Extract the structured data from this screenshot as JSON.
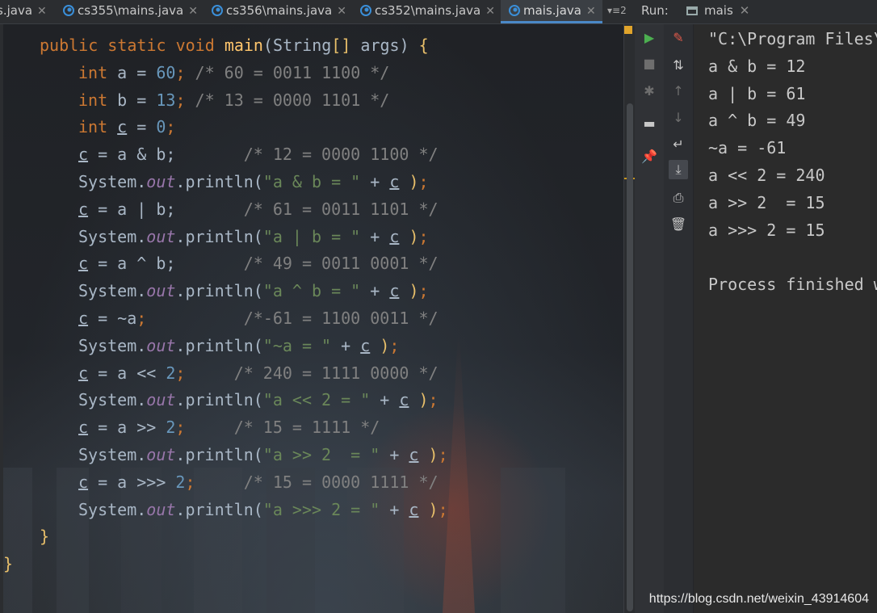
{
  "tabs": [
    {
      "name": "s.java",
      "active": false
    },
    {
      "name": "cs355\\mains.java",
      "active": false
    },
    {
      "name": "cs356\\mains.java",
      "active": false
    },
    {
      "name": "cs352\\mains.java",
      "active": false
    },
    {
      "name": "mais.java",
      "active": true
    }
  ],
  "tab_overflow_label": "≡2",
  "run": {
    "label": "Run:",
    "tab_name": "mais"
  },
  "editor": {
    "lines": [
      [
        [
          "kw",
          "public "
        ],
        [
          "kw",
          "static "
        ],
        [
          "kw",
          "void "
        ],
        [
          "fn",
          "main"
        ],
        [
          "p",
          "(String"
        ],
        [
          "br",
          "[]"
        ],
        [
          "p",
          " args) "
        ],
        [
          "br",
          "{"
        ]
      ],
      [
        [
          "kw",
          "int "
        ],
        [
          "p",
          "a = "
        ],
        [
          "num",
          "60"
        ],
        [
          "kw",
          "; "
        ],
        [
          "cm",
          "/* 60 = 0011 1100 */"
        ]
      ],
      [
        [
          "kw",
          "int "
        ],
        [
          "p",
          "b = "
        ],
        [
          "num",
          "13"
        ],
        [
          "kw",
          "; "
        ],
        [
          "cm",
          "/* 13 = 0000 1101 */"
        ]
      ],
      [
        [
          "kw",
          "int "
        ],
        [
          "var",
          "c"
        ],
        [
          "p",
          " = "
        ],
        [
          "num",
          "0"
        ],
        [
          "kw",
          ";"
        ]
      ],
      [
        [
          "var",
          "c"
        ],
        [
          "p",
          " = a & b;       "
        ],
        [
          "cm",
          "/* 12 = 0000 1100 */"
        ]
      ],
      [
        [
          "p",
          "System."
        ],
        [
          "fld",
          "out"
        ],
        [
          "p",
          ".println("
        ],
        [
          "st",
          "\"a & b = \""
        ],
        [
          "p",
          " + "
        ],
        [
          "var",
          "c"
        ],
        [
          "p",
          " "
        ],
        [
          "br",
          ")"
        ],
        [
          "kw",
          ";"
        ]
      ],
      [
        [
          "var",
          "c"
        ],
        [
          "p",
          " = a | b;       "
        ],
        [
          "cm",
          "/* 61 = 0011 1101 */"
        ]
      ],
      [
        [
          "p",
          "System."
        ],
        [
          "fld",
          "out"
        ],
        [
          "p",
          ".println("
        ],
        [
          "st",
          "\"a | b = \""
        ],
        [
          "p",
          " + "
        ],
        [
          "var",
          "c"
        ],
        [
          "p",
          " "
        ],
        [
          "br",
          ")"
        ],
        [
          "kw",
          ";"
        ]
      ],
      [
        [
          "var",
          "c"
        ],
        [
          "p",
          " = a ^ b;       "
        ],
        [
          "cm",
          "/* 49 = 0011 0001 */"
        ]
      ],
      [
        [
          "p",
          "System."
        ],
        [
          "fld",
          "out"
        ],
        [
          "p",
          ".println("
        ],
        [
          "st",
          "\"a ^ b = \""
        ],
        [
          "p",
          " + "
        ],
        [
          "var",
          "c"
        ],
        [
          "p",
          " "
        ],
        [
          "br",
          ")"
        ],
        [
          "kw",
          ";"
        ]
      ],
      [
        [
          "var",
          "c"
        ],
        [
          "p",
          " = ~a"
        ],
        [
          "kw",
          ";"
        ],
        [
          "p",
          "          "
        ],
        [
          "cm",
          "/*-61 = 1100 0011 */"
        ]
      ],
      [
        [
          "p",
          "System."
        ],
        [
          "fld",
          "out"
        ],
        [
          "p",
          ".println("
        ],
        [
          "st",
          "\"~a = \""
        ],
        [
          "p",
          " + "
        ],
        [
          "var",
          "c"
        ],
        [
          "p",
          " "
        ],
        [
          "br",
          ")"
        ],
        [
          "kw",
          ";"
        ]
      ],
      [
        [
          "var",
          "c"
        ],
        [
          "p",
          " = a << "
        ],
        [
          "num",
          "2"
        ],
        [
          "kw",
          ";"
        ],
        [
          "p",
          "     "
        ],
        [
          "cm",
          "/* 240 = 1111 0000 */"
        ]
      ],
      [
        [
          "p",
          "System."
        ],
        [
          "fld",
          "out"
        ],
        [
          "p",
          ".println("
        ],
        [
          "st",
          "\"a << 2 = \""
        ],
        [
          "p",
          " + "
        ],
        [
          "var",
          "c"
        ],
        [
          "p",
          " "
        ],
        [
          "br",
          ")"
        ],
        [
          "kw",
          ";"
        ]
      ],
      [
        [
          "var",
          "c"
        ],
        [
          "p",
          " = a >> "
        ],
        [
          "num",
          "2"
        ],
        [
          "kw",
          ";"
        ],
        [
          "p",
          "     "
        ],
        [
          "cm",
          "/* 15 = 1111 */"
        ]
      ],
      [
        [
          "p",
          "System."
        ],
        [
          "fld",
          "out"
        ],
        [
          "p",
          ".println("
        ],
        [
          "st",
          "\"a >> 2  = \""
        ],
        [
          "p",
          " + "
        ],
        [
          "var",
          "c"
        ],
        [
          "p",
          " "
        ],
        [
          "br",
          ")"
        ],
        [
          "kw",
          ";"
        ]
      ],
      [
        [
          "var",
          "c"
        ],
        [
          "p",
          " = a >>> "
        ],
        [
          "num",
          "2"
        ],
        [
          "kw",
          ";"
        ],
        [
          "p",
          "     "
        ],
        [
          "cm",
          "/* 15 = 0000 1111 */"
        ]
      ],
      [
        [
          "p",
          "System."
        ],
        [
          "fld",
          "out"
        ],
        [
          "p",
          ".println("
        ],
        [
          "st",
          "\"a >>> 2 = \""
        ],
        [
          "p",
          " + "
        ],
        [
          "var",
          "c"
        ],
        [
          "p",
          " "
        ],
        [
          "br",
          ")"
        ],
        [
          "kw",
          ";"
        ]
      ],
      [
        [
          "br",
          "}"
        ]
      ],
      [
        [
          "br",
          "}"
        ]
      ]
    ],
    "indents": [
      1,
      2,
      2,
      2,
      2,
      2,
      2,
      2,
      2,
      2,
      2,
      2,
      2,
      2,
      2,
      2,
      2,
      2,
      1,
      0
    ]
  },
  "console": {
    "lines": [
      "\"C:\\Program Files\\",
      "a & b = 12",
      "a | b = 61",
      "a ^ b = 49",
      "~a = -61",
      "a << 2 = 240",
      "a >> 2  = 15",
      "a >>> 2 = 15",
      "",
      "Process finished w"
    ]
  },
  "toolbar_left": [
    {
      "icon": "run-icon",
      "glyph": "▶",
      "color": "#4caf50"
    },
    {
      "icon": "stop-icon",
      "glyph": "■",
      "color": "#6e6e6e"
    },
    {
      "icon": "debug-icon",
      "glyph": "✱",
      "color": "#6e6e6e"
    },
    {
      "icon": "layout-icon",
      "glyph": "▬",
      "color": "#c8c8c8"
    },
    {
      "icon": "pin-icon",
      "glyph": "📌",
      "color": "#c8c8c8"
    }
  ],
  "toolbar_right": [
    {
      "icon": "clear-icon",
      "glyph": "✎",
      "color": "#e05a4a"
    },
    {
      "icon": "sort-icon",
      "glyph": "⇅",
      "color": "#c8c8c8"
    },
    {
      "icon": "up-icon",
      "glyph": "↑",
      "color": "#6e6e6e"
    },
    {
      "icon": "down-icon",
      "glyph": "↓",
      "color": "#6e6e6e"
    },
    {
      "icon": "soft-wrap-icon",
      "glyph": "↵",
      "color": "#c8c8c8"
    },
    {
      "icon": "scroll-to-end-icon",
      "glyph": "⤓",
      "color": "#c8c8c8"
    },
    {
      "icon": "print-icon",
      "glyph": "⎙",
      "color": "#c8c8c8"
    },
    {
      "icon": "trash-icon",
      "glyph": "🗑",
      "color": "#c8c8c8"
    }
  ],
  "watermark": "https://blog.csdn.net/weixin_43914604"
}
